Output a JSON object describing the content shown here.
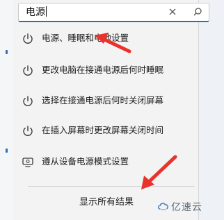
{
  "search": {
    "query": "电源"
  },
  "results": [
    {
      "label": "电源、睡眠和电池设置",
      "icon": "power-icon"
    },
    {
      "label": "更改电脑在接通电源后何时睡眠",
      "icon": "power-icon"
    },
    {
      "label": "选择在接通电源后何时关闭屏幕",
      "icon": "power-icon"
    },
    {
      "label": "在插入屏幕时更改屏幕关闭时间",
      "icon": "power-icon"
    },
    {
      "label": "遵从设备电源模式设置",
      "icon": "device-power-icon"
    }
  ],
  "footer": {
    "show_all": "显示所有结果"
  },
  "watermark": {
    "text": "亿速云"
  },
  "colors": {
    "accent": "#2a6cc7",
    "arrow": "#e8322b",
    "icon": "#3a3a3a"
  }
}
